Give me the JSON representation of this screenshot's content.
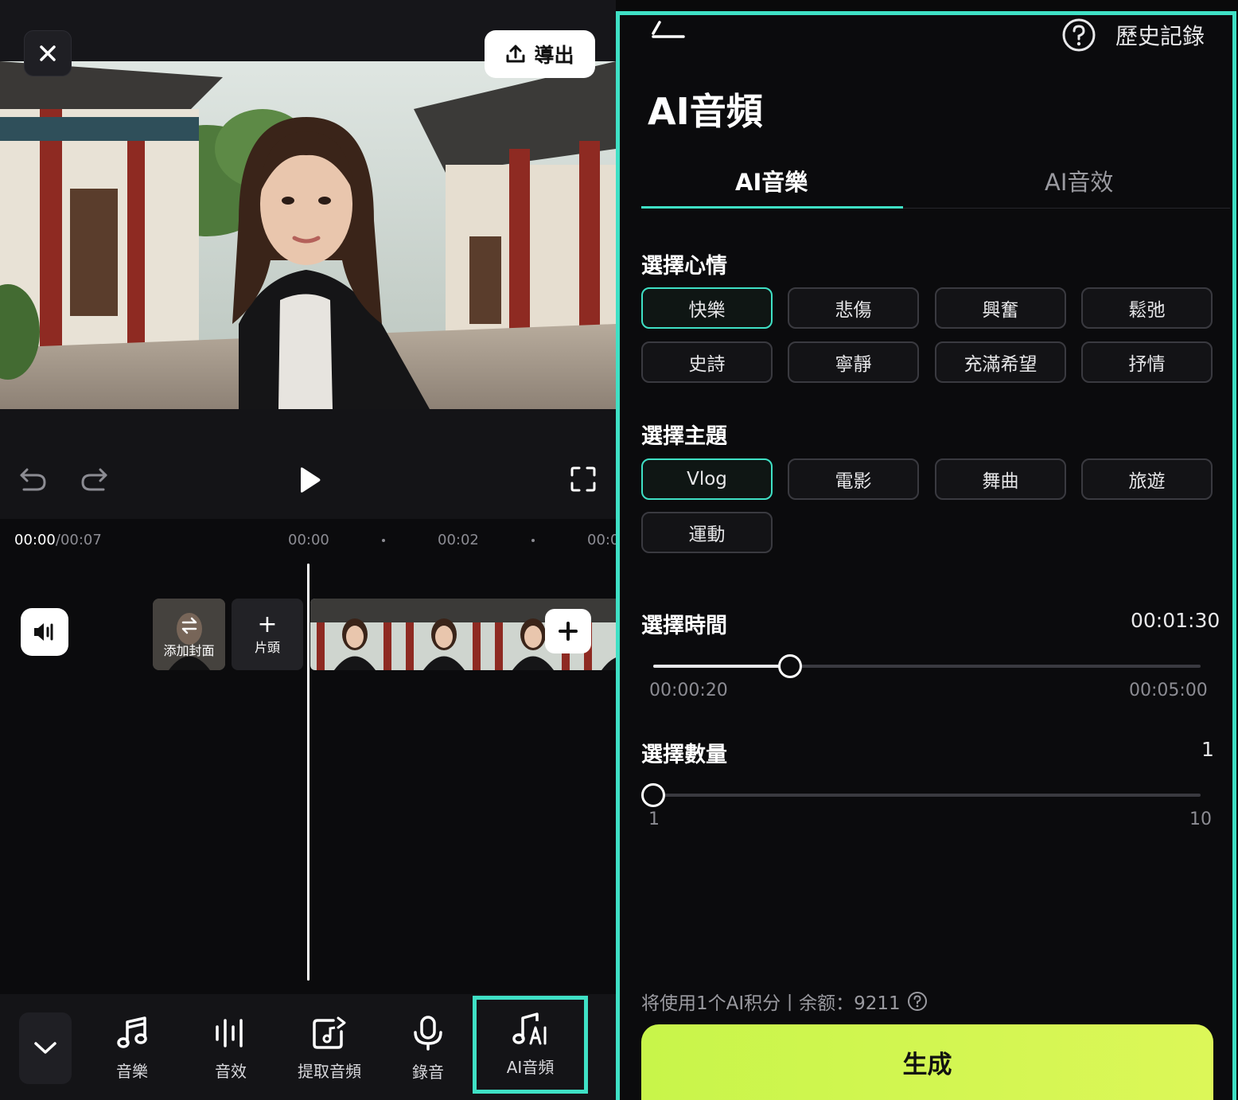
{
  "editor": {
    "export_label": "導出",
    "time_current": "00:00",
    "time_total": "/00:07",
    "ruler_ticks": [
      "00:00",
      "00:02",
      "00:0"
    ],
    "cover_label": "添加封面",
    "intro_label": "片頭",
    "intro_plus": "+",
    "toolbar": [
      {
        "label": "音樂",
        "icon": "music-note-icon"
      },
      {
        "label": "音效",
        "icon": "sound-wave-icon"
      },
      {
        "label": "提取音頻",
        "icon": "extract-audio-icon"
      },
      {
        "label": "錄音",
        "icon": "microphone-icon"
      },
      {
        "label": "AI音頻",
        "icon": "ai-music-icon"
      }
    ]
  },
  "panel": {
    "history_label": "歷史記錄",
    "title": "AI音頻",
    "tabs": [
      {
        "label": "AI音樂",
        "active": true
      },
      {
        "label": "AI音效",
        "active": false
      }
    ],
    "mood": {
      "title": "選擇心情",
      "options": [
        "快樂",
        "悲傷",
        "興奮",
        "鬆弛",
        "史詩",
        "寧靜",
        "充滿希望",
        "抒情"
      ],
      "selected": "快樂"
    },
    "theme": {
      "title": "選擇主題",
      "options": [
        "Vlog",
        "電影",
        "舞曲",
        "旅遊",
        "運動"
      ],
      "selected": "Vlog"
    },
    "duration": {
      "title": "選擇時間",
      "value": "00:01:30",
      "min_label": "00:00:20",
      "max_label": "00:05:00",
      "fraction": 0.25
    },
    "count": {
      "title": "選擇數量",
      "value": "1",
      "min_label": "1",
      "max_label": "10",
      "fraction": 0
    },
    "credit_note": "将使用1个AI积分丨余额：9211",
    "generate_label": "生成"
  },
  "colors": {
    "accent": "#3fe0c5",
    "generate": "#d4f550",
    "background": "#0b0b0d"
  }
}
